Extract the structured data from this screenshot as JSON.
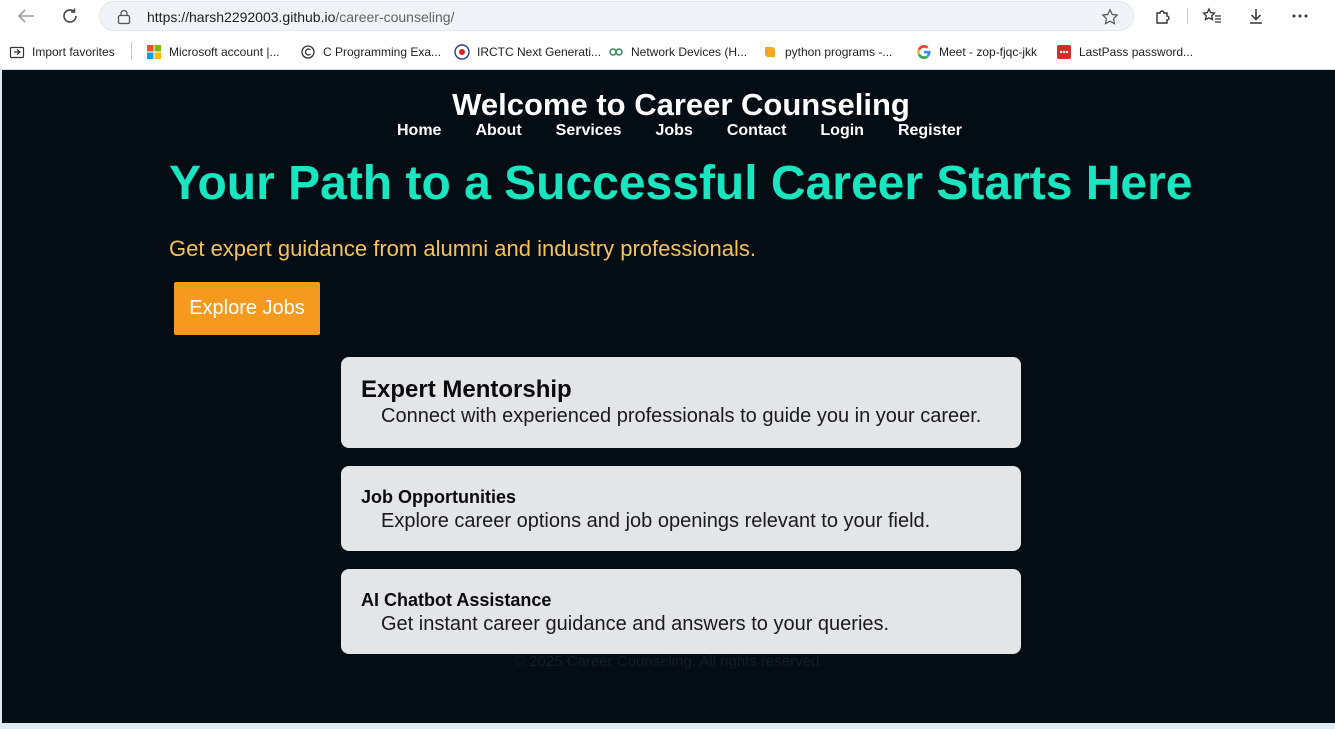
{
  "browser": {
    "url_host": "https://harsh2292003.github.io",
    "url_path": "/career-counseling/"
  },
  "favorites": [
    {
      "label": "Import favorites",
      "icon": "import-icon"
    },
    {
      "label": "Microsoft account |...",
      "icon": "microsoft-icon"
    },
    {
      "label": "C Programming Exa...",
      "icon": "c-programming-icon"
    },
    {
      "label": "IRCTC Next Generati...",
      "icon": "irctc-icon"
    },
    {
      "label": "Network Devices (H...",
      "icon": "network-icon"
    },
    {
      "label": "python programs -...",
      "icon": "python-icon"
    },
    {
      "label": "Meet - zop-fjqc-jkk",
      "icon": "google-icon"
    },
    {
      "label": "LastPass password...",
      "icon": "lastpass-icon"
    }
  ],
  "site": {
    "title": "Welcome to Career Counseling",
    "nav": [
      "Home",
      "About",
      "Services",
      "Jobs",
      "Contact",
      "Login",
      "Register"
    ]
  },
  "hero": {
    "title": "Your Path to a Successful Career Starts Here",
    "subtitle": "Get expert guidance from alumni and industry professionals.",
    "cta": "Explore Jobs"
  },
  "features": [
    {
      "title": "Expert Mentorship",
      "text": "Connect with experienced professionals to guide you in your career."
    },
    {
      "title": "Job Opportunities",
      "text": "Explore career options and job openings relevant to your field."
    },
    {
      "title": "AI Chatbot Assistance",
      "text": "Get instant career guidance and answers to your queries."
    }
  ],
  "footer": "© 2025 Career Counseling. All rights reserved.",
  "colors": {
    "page_bg": "#040c14",
    "hero_title": "#19e6c1",
    "hero_subtitle": "#f4c35a",
    "cta_bg": "#f5991f",
    "card_bg": "#e4e5e7"
  }
}
